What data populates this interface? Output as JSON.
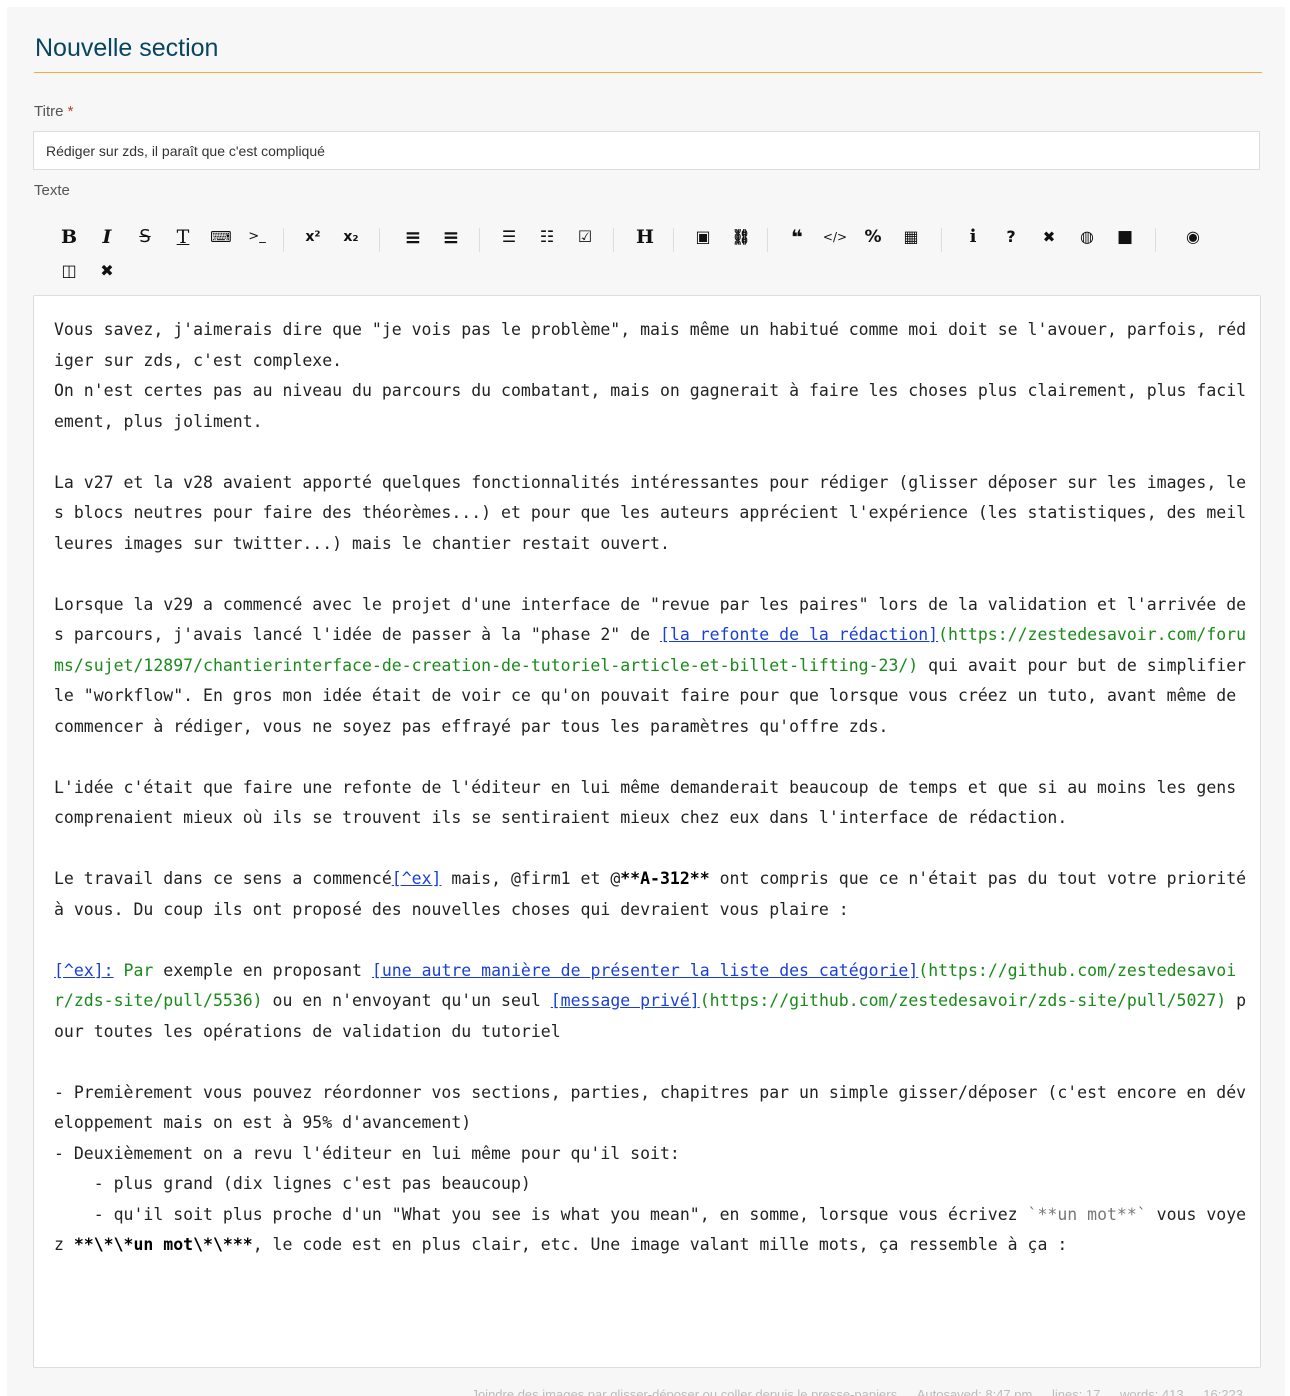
{
  "section": {
    "heading": "Nouvelle section"
  },
  "title_field": {
    "label": "Titre",
    "required_mark": "*",
    "value": "Rédiger sur zds, il paraît que c'est compliqué"
  },
  "text_field": {
    "label": "Texte"
  },
  "colors": {
    "heading": "#084561",
    "accent_rule": "#f8ad32",
    "link_text": "#1a3fd4",
    "url": "#1a8a1a",
    "required": "#c0392b"
  },
  "toolbar": {
    "buttons": [
      {
        "id": "bold",
        "glyph": "B",
        "icon": "bold-icon"
      },
      {
        "id": "italic",
        "glyph": "I",
        "icon": "italic-icon"
      },
      {
        "id": "strike",
        "glyph": "S",
        "icon": "strikethrough-icon"
      },
      {
        "id": "abbr",
        "glyph": "T",
        "icon": "abbreviation-icon"
      },
      {
        "id": "keyboard",
        "glyph": "⌨",
        "icon": "keyboard-icon"
      },
      {
        "id": "terminal",
        "glyph": ">_",
        "icon": "terminal-icon"
      },
      {
        "id": "sup",
        "glyph": "x²",
        "icon": "superscript-icon"
      },
      {
        "id": "sub",
        "glyph": "x₂",
        "icon": "subscript-icon"
      },
      {
        "id": "align-center",
        "glyph": "≡",
        "icon": "align-center-icon"
      },
      {
        "id": "align-right",
        "glyph": "≡",
        "icon": "align-right-icon"
      },
      {
        "id": "ul",
        "glyph": "☰",
        "icon": "bulleted-list-icon"
      },
      {
        "id": "ol",
        "glyph": "☷",
        "icon": "numbered-list-icon"
      },
      {
        "id": "checklist",
        "glyph": "☑",
        "icon": "checklist-icon"
      },
      {
        "id": "heading",
        "glyph": "H",
        "icon": "heading-icon"
      },
      {
        "id": "image",
        "glyph": "▣",
        "icon": "image-icon"
      },
      {
        "id": "link",
        "glyph": "🔗",
        "icon": "link-icon"
      },
      {
        "id": "quote",
        "glyph": "❝",
        "icon": "quote-icon"
      },
      {
        "id": "code",
        "glyph": "</>",
        "icon": "code-icon"
      },
      {
        "id": "math",
        "glyph": "%",
        "icon": "math-icon"
      },
      {
        "id": "table",
        "glyph": "▦",
        "icon": "table-icon"
      },
      {
        "id": "info",
        "glyph": "i",
        "icon": "info-block-icon"
      },
      {
        "id": "question",
        "glyph": "?",
        "icon": "question-block-icon"
      },
      {
        "id": "error",
        "glyph": "✖",
        "icon": "error-block-icon"
      },
      {
        "id": "secret",
        "glyph": "◍",
        "icon": "hidden-block-icon"
      },
      {
        "id": "neutral",
        "glyph": "■",
        "icon": "neutral-block-icon"
      },
      {
        "id": "preview",
        "glyph": "◉",
        "icon": "eye-icon"
      },
      {
        "id": "side-by-side",
        "glyph": "◫",
        "icon": "side-by-side-icon"
      },
      {
        "id": "fullscreen",
        "glyph": "✕",
        "icon": "fullscreen-icon"
      }
    ]
  },
  "editor": {
    "p1a": "Vous savez, j'aimerais dire que \"je vois pas le problème\", mais même un habitué comme moi doit se l'avouer, parfois, rédiger sur zds, c'est complexe.",
    "p1b": "On n'est certes pas au niveau du parcours du combatant, mais on gagnerait à faire les choses plus clairement, plus facilement, plus joliment.",
    "p2": "La v27 et la v28 avaient apporté quelques fonctionnalités intéressantes pour rédiger (glisser déposer sur les images, les blocs neutres pour faire des théorèmes...) et pour que les auteurs apprécient l'expérience (les statistiques, des meilleures images sur twitter...) mais le chantier restait ouvert.",
    "p3_before": "Lorsque la v29 a commencé avec le projet d'une interface de \"revue par les paires\" lors de la validation et l'arrivée des parcours, j'avais lancé l'idée de passer à la \"phase 2\" de ",
    "p3_link": "[la refonte de la rédaction]",
    "p3_url": "(https://zestedesavoir.com/forums/sujet/12897/chantierinterface-de-creation-de-tutoriel-article-et-billet-lifting-23/)",
    "p3_after": " qui avait pour but de simplifier le \"workflow\". En gros mon idée était de voir ce qu'on pouvait faire pour que lorsque vous créez un tuto, avant même de commencer à rédiger, vous ne soyez pas effrayé par tous les paramètres qu'offre zds.",
    "p4": "L'idée c'était que faire une refonte de l'éditeur en lui même demanderait beaucoup de temps et que si au moins les gens comprenaient mieux où ils se trouvent ils se sentiraient mieux chez eux dans l'interface de rédaction.",
    "p5_a": "Le travail dans ce sens a commencé",
    "p5_fn": "[^ex]",
    "p5_b": " mais, @firm1 et @",
    "p5_strong": "**A-312**",
    "p5_c": " ont compris que ce n'était pas du tout votre priorité à vous. Du coup ils ont proposé des nouvelles choses qui devraient vous plaire :",
    "fn_ref": "[^ex]:",
    "fn_a": " Par",
    "fn_b": " exemple en proposant ",
    "fn_link1": "[une autre manière de présenter la liste des catégorie]",
    "fn_url1": "(https://github.com/zestedesavoir/zds-site/pull/5536)",
    "fn_c": " ou en n'envoyant qu'un seul ",
    "fn_link2": "[message privé]",
    "fn_url2": "(https://github.com/zestedesavoir/zds-site/pull/5027)",
    "fn_d": " pour toutes les opérations de validation du tutoriel",
    "li1": "- Premièrement vous pouvez réordonner vos sections, parties, chapitres par un simple gisser/déposer (c'est encore en développement mais on est à 95% d'avancement)",
    "li2": "- Deuxièmement on a revu l'éditeur en lui même pour qu'il soit:",
    "li2a": "    - plus grand (dix lignes c'est pas beaucoup)",
    "li2b_a": "    - qu'il soit plus proche d'un \"What you see is what you mean\", en somme, lorsque vous écrivez ",
    "li2b_code": "`**un mot**`",
    "li2b_b": " vous voyez ",
    "li2b_strong": "**\\*\\*un mot\\*\\***",
    "li2b_c": ", le code est en plus clair, etc. Une image valant mille mots, ça ressemble à ça :"
  },
  "status_bar": {
    "hint": "Joindre des images par glisser-déposer ou coller depuis le presse-papiers",
    "autosaved": "Autosaved: 8:47 pm",
    "lines": "lines: 17",
    "words": "words: 413",
    "cursor": "16:223"
  }
}
